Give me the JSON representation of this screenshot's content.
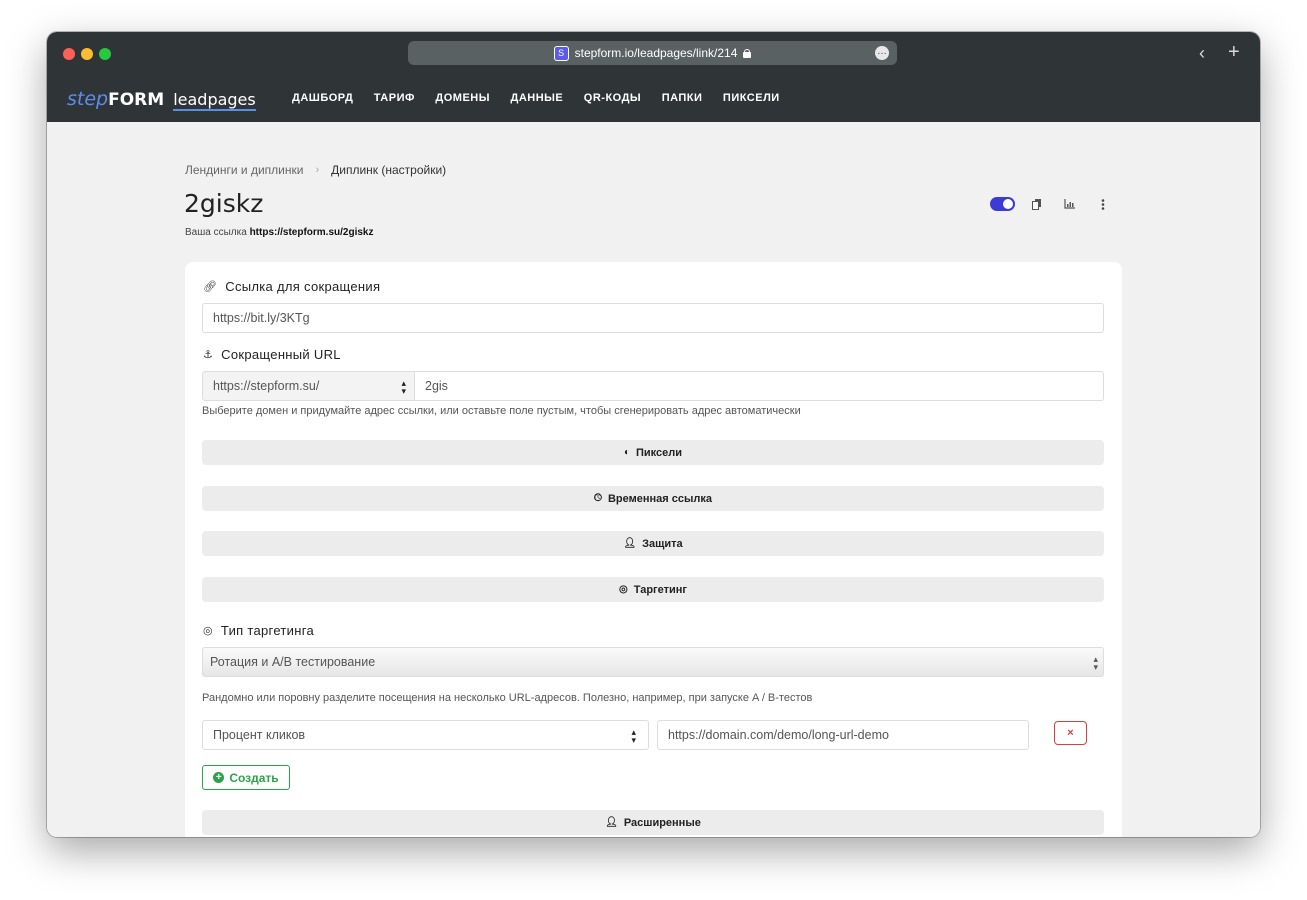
{
  "browser": {
    "url": "stepform.io/leadpages/link/214",
    "favicon_letter": "S"
  },
  "navbar": {
    "logo_step": "step",
    "logo_form": "FORM",
    "logo_leadpages": "leadpages",
    "menu": [
      "ДАШБОРД",
      "ТАРИФ",
      "ДОМЕНЫ",
      "ДАННЫЕ",
      "QR-КОДЫ",
      "ПАПКИ",
      "ПИКСЕЛИ"
    ]
  },
  "breadcrumb": {
    "parent": "Лендинги и диплинки",
    "separator": "›",
    "current": "Диплинк (настройки)"
  },
  "page": {
    "title": "2giskz",
    "your_link_label": "Ваша ссылка",
    "your_link_url": "https://stepform.su/2giskz",
    "enabled": true
  },
  "form": {
    "shorten_label": "Ссылка для сокращения",
    "shorten_value": "https://bit.ly/3KTg",
    "short_url_label": "Сокращенный URL",
    "domain_value": "https://stepform.su/",
    "alias_value": "2gis",
    "short_url_help": "Выберите домен и придумайте адрес ссылки, или оставьте поле пустым, чтобы сгенерировать адрес автоматически",
    "accordions": {
      "pixels": "Пиксели",
      "temporary": "Временная ссылка",
      "protection": "Защита",
      "targeting": "Таргетинг",
      "advanced": "Расширенные"
    },
    "targeting_type_label": "Тип таргетинга",
    "targeting_type_value": "Ротация и A/B тестирование",
    "targeting_help": "Рандомно или поровну разделите посещения на несколько URL-адресов. Полезно, например, при запуске A / B-тестов",
    "percent_placeholder": "Процент кликов",
    "target_url_value": "https://domain.com/demo/long-url-demo",
    "remove_label": "×",
    "create_label": "Создать"
  },
  "colors": {
    "accent": "#3b3bd8",
    "navbar": "#2f3537",
    "success": "#2ca34a",
    "danger": "#e03c3c"
  }
}
